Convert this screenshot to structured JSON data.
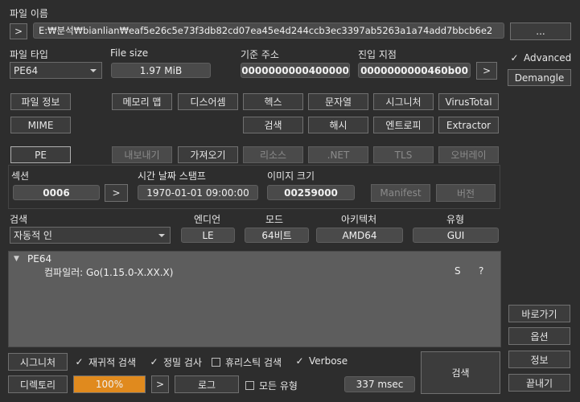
{
  "file": {
    "name_label": "파일 이름",
    "path": "E:₩분석₩bianlian₩eaf5e26c5e73f3db82cd07ea45e4d244ccb3ec3397ab5263a1a74add7bbcb6e2",
    "nav_glyph": ">",
    "browse_label": "..."
  },
  "info": {
    "type_label": "파일 타입",
    "type_value": "PE64",
    "size_label": "File size",
    "size_value": "1.97 MiB",
    "base_label": "기준 주소",
    "base_value": "0000000000400000",
    "entry_label": "진입 지점",
    "entry_value": "0000000000460b00",
    "entry_nav": ">"
  },
  "right_panel": {
    "advanced_label": "Advanced",
    "advanced_checked": true,
    "demangle_label": "Demangle"
  },
  "tools": {
    "row1": [
      "파일 정보",
      "메모리 맵",
      "디스어셈",
      "헥스",
      "문자열",
      "시그니처",
      "VirusTotal"
    ],
    "row2": [
      "MIME",
      "검색",
      "해시",
      "엔트로피",
      "Extractor"
    ]
  },
  "pe": {
    "pe_label": "PE",
    "buttons": [
      "내보내기",
      "가져오기",
      "리소스",
      ".NET",
      "TLS",
      "오버레이"
    ],
    "section_label": "섹션",
    "section_value": "0006",
    "section_nav": ">",
    "timestamp_label": "시간 날짜 스탬프",
    "timestamp_value": "1970-01-01 09:00:00",
    "image_size_label": "이미지 크기",
    "image_size_value": "00259000",
    "manifest_label": "Manifest",
    "version_label": "버전"
  },
  "scan": {
    "scan_label": "검색",
    "scan_mode": "자동적 인",
    "endian_label": "엔디언",
    "endian_value": "LE",
    "mode_label": "모드",
    "mode_value": "64비트",
    "arch_label": "아키텍처",
    "arch_value": "AMD64",
    "type_label": "유형",
    "type_value": "GUI"
  },
  "results": {
    "root": "PE64",
    "expander_glyph": "▼",
    "items": [
      {
        "text": "컴파일러: Go(1.15.0-X.XX.X)",
        "flag": "S",
        "info": "?"
      }
    ]
  },
  "side_buttons": {
    "shortcut": "바로가기",
    "options": "옵션",
    "about": "정보",
    "exit": "끝내기"
  },
  "bottom": {
    "signature_button": "시그니처",
    "recursive_label": "재귀적 검색",
    "recursive_checked": true,
    "deep_label": "정밀 검사",
    "deep_checked": true,
    "heuristic_label": "휴리스틱 검색",
    "heuristic_checked": false,
    "verbose_label": "Verbose",
    "verbose_checked": true,
    "directory_button": "디렉토리",
    "progress_text": "100%",
    "progress_value": 1.0,
    "progress_nav": ">",
    "log_button": "로그",
    "all_types_label": "모든 유형",
    "all_types_checked": false,
    "elapsed": "337 msec",
    "scan_button": "검색"
  },
  "colors": {
    "background": "#2d2d2d",
    "progress": "#e08a1e",
    "field": "#4a4a4a"
  }
}
